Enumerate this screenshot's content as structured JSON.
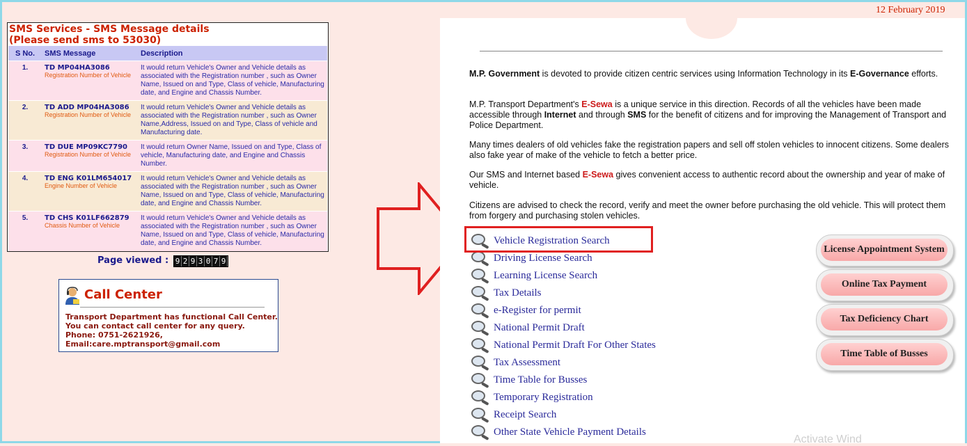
{
  "sms": {
    "title_line1": "SMS Services - SMS Message details",
    "title_line2": "(Please send sms to 53030)",
    "headers": {
      "sno": "S No.",
      "message": "SMS Message",
      "description": "Description"
    },
    "rows": [
      {
        "sno": "1.",
        "cmd": "TD MP04HA3086",
        "sub": "Registration Number of Vehicle",
        "desc": "It would return Vehicle's Owner and Vehicle details as associated with the Registration number , such as Owner Name, Issued on and Type, Class of vehicle, Manufacturing date, and Engine and Chassis Number."
      },
      {
        "sno": "2.",
        "cmd": "TD ADD MP04HA3086",
        "sub": "Registration Number of Vehicle",
        "desc": "It would return Vehicle's Owner and Vehicle details as associated with the Registration number , such as Owner Name,Address, Issued on and Type, Class of vehicle and Manufacturing date."
      },
      {
        "sno": "3.",
        "cmd": "TD DUE MP09KC7790",
        "sub": "Registration Number of Vehicle",
        "desc": "It would return Owner Name, Issued on and Type, Class of vehicle, Manufacturing date, and Engine and Chassis Number."
      },
      {
        "sno": "4.",
        "cmd": "TD ENG K01LM654017",
        "sub": "Engine Number of Vehicle",
        "desc": "It would return Vehicle's Owner and Vehicle details as associated with the Registration number , such as Owner Name, Issued on and Type, Class of vehicle, Manufacturing date, and Engine and Chassis Number."
      },
      {
        "sno": "5.",
        "cmd": "TD CHS K01LF662879",
        "sub": "Chassis Number of Vehicle",
        "desc": "It would return Vehicle's Owner and Vehicle details as associated with the Registration number , such as Owner Name, Issued on and Type, Class of vehicle, Manufacturing date, and Engine and Chassis Number."
      }
    ]
  },
  "page_viewed": {
    "label": "Page viewed :",
    "digits": [
      "9",
      "2",
      "9",
      "3",
      "0",
      "7",
      "9"
    ]
  },
  "call_center": {
    "title": "Call Center",
    "line1": "Transport Department has functional Call Center.",
    "line2": "You can contact call center for any query.",
    "line3": "Phone: 0751-2621926,",
    "line4": "Email:care.mptransport@gmail.com"
  },
  "date": "12 February 2019",
  "intro": {
    "p1_a": "M.P. Government",
    "p1_b": " is devoted to provide citizen centric services using Information Technology in its ",
    "p1_c": "E-Governance",
    "p1_d": " efforts.",
    "p2_a": "M.P. Transport Department's ",
    "p2_b": "E-Sewa",
    "p2_c": " is a unique service in this direction. Records of all the vehicles have been made accessible through ",
    "p2_d": "Internet",
    "p2_e": " and through ",
    "p2_f": "SMS",
    "p2_g": " for the benefit of citizens and for improving the Management of Transport and Police Department.",
    "p3": "Many times dealers of old vehicles fake the registration papers and sell off stolen vehicles to innocent citizens. Some dealers also fake year of make of the vehicle to fetch a better price.",
    "p4_a": "Our SMS and Internet based ",
    "p4_b": "E-Sewa",
    "p4_c": " gives convenient access to authentic record about the ownership and year of make of vehicle.",
    "p5": "Citizens are advised to check the record, verify and meet the owner before purchasing the old vehicle. This will protect them from forgery and purchasing stolen vehicles."
  },
  "links": [
    "Vehicle Registration Search",
    "Driving License Search",
    "Learning License Search",
    "Tax Details",
    "e-Register for permit",
    "National Permit Draft",
    "National Permit Draft For Other States",
    "Tax Assessment",
    "Time Table for Busses",
    "Temporary Registration",
    "Receipt Search",
    "Other State Vehicle Payment Details"
  ],
  "buttons": [
    "License Appointment System",
    "Online Tax Payment",
    "Tax Deficiency Chart",
    "Time Table of Busses"
  ],
  "watermark": "Activate Wind"
}
